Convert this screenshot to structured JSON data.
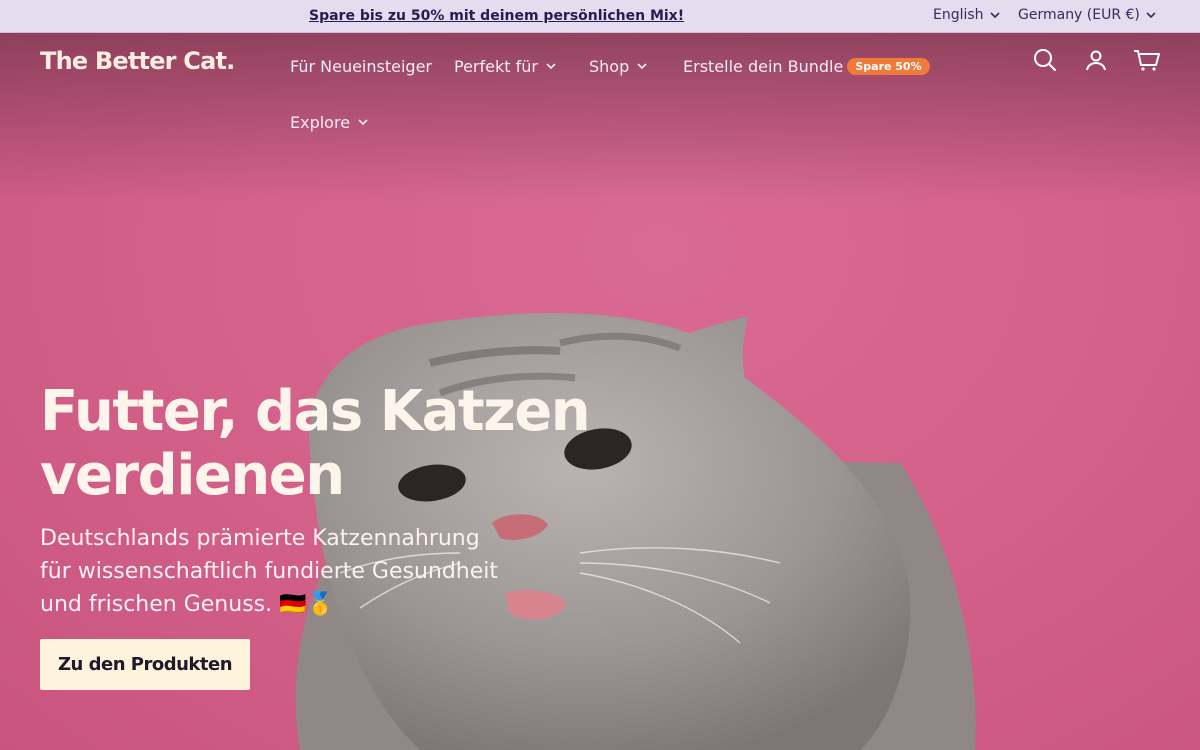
{
  "announcement": {
    "text": "Spare bis zu 50% mit deinem persönlichen Mix!"
  },
  "locale": {
    "language": "English",
    "country": "Germany (EUR €)"
  },
  "header": {
    "logo": "The Better Cat.",
    "nav": [
      {
        "label": "Für Neueinsteiger"
      },
      {
        "label": "Perfekt für"
      },
      {
        "label": "Shop"
      },
      {
        "label": "Erstelle dein Bundle",
        "badge": "Spare 50%"
      },
      {
        "label": "Explore"
      }
    ],
    "icons": [
      "search-icon",
      "account-icon",
      "cart-icon"
    ]
  },
  "hero": {
    "headline": "Futter, das Katzen verdienen",
    "subline": "Deutschlands prämierte Katzennahrung für wissenschaftlich fundierte Gesundheit und frischen Genuss. 🇩🇪🥇",
    "cta": "Zu den Produkten"
  },
  "colors": {
    "announcement_bg": "#e6dcef",
    "hero_bg": "#d4628a",
    "badge": "#f07a3a",
    "cta_bg": "#fdf3dd",
    "logo": "#fbeee0"
  }
}
